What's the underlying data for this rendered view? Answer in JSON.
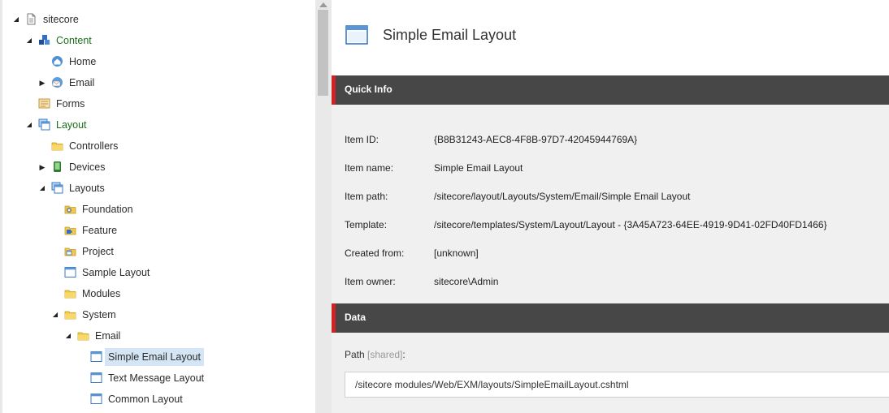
{
  "tree": {
    "nodes": [
      {
        "label": "sitecore",
        "icon": "document-icon",
        "expanded": true,
        "green": false
      },
      {
        "label": "Content",
        "icon": "content-cubes-icon",
        "expanded": true,
        "green": true
      },
      {
        "label": "Home",
        "icon": "home-icon",
        "expanded": null,
        "green": false
      },
      {
        "label": "Email",
        "icon": "email-globe-icon",
        "expanded": false,
        "green": false
      },
      {
        "label": "Forms",
        "icon": "forms-icon",
        "expanded": null,
        "green": false
      },
      {
        "label": "Layout",
        "icon": "layout-icon",
        "expanded": true,
        "green": true
      },
      {
        "label": "Controllers",
        "icon": "folder-icon",
        "expanded": null,
        "green": false
      },
      {
        "label": "Devices",
        "icon": "device-icon",
        "expanded": false,
        "green": false
      },
      {
        "label": "Layouts",
        "icon": "layout-icon",
        "expanded": true,
        "green": false
      },
      {
        "label": "Foundation",
        "icon": "folder-gear-icon",
        "expanded": null,
        "green": false
      },
      {
        "label": "Feature",
        "icon": "folder-puzzle-icon",
        "expanded": null,
        "green": false
      },
      {
        "label": "Project",
        "icon": "folder-layout-icon",
        "expanded": null,
        "green": false
      },
      {
        "label": "Sample Layout",
        "icon": "window-icon",
        "expanded": null,
        "green": false
      },
      {
        "label": "Modules",
        "icon": "folder-icon",
        "expanded": null,
        "green": false
      },
      {
        "label": "System",
        "icon": "folder-icon",
        "expanded": true,
        "green": false
      },
      {
        "label": "Email",
        "icon": "folder-icon",
        "expanded": true,
        "green": false
      },
      {
        "label": "Simple Email Layout",
        "icon": "window-icon",
        "expanded": null,
        "green": false,
        "selected": true
      },
      {
        "label": "Text Message Layout",
        "icon": "window-icon",
        "expanded": null,
        "green": false
      },
      {
        "label": "Common Layout",
        "icon": "window-icon",
        "expanded": null,
        "green": false
      }
    ]
  },
  "header": {
    "title": "Simple Email Layout",
    "icon": "window-icon"
  },
  "quick_info": {
    "title": "Quick Info",
    "rows": [
      {
        "label": "Item ID:",
        "value": "{B8B31243-AEC8-4F8B-97D7-42045944769A}"
      },
      {
        "label": "Item name:",
        "value": "Simple Email Layout"
      },
      {
        "label": "Item path:",
        "value": "/sitecore/layout/Layouts/System/Email/Simple Email Layout"
      },
      {
        "label": "Template:",
        "value": "/sitecore/templates/System/Layout/Layout - {3A45A723-64EE-4919-9D41-02FD40FD1466}"
      },
      {
        "label": "Created from:",
        "value": "[unknown]"
      },
      {
        "label": "Item owner:",
        "value": "sitecore\\Admin"
      }
    ]
  },
  "data_section": {
    "title": "Data",
    "path_label": "Path",
    "path_shared": "[shared]",
    "path_colon": ":",
    "path_value": "/sitecore modules/Web/EXM/layouts/SimpleEmailLayout.cshtml"
  },
  "colors": {
    "accent": "#d02424",
    "section_bg": "#474747",
    "selected_bg": "#d4e6f5",
    "green_label": "#1b6d1b"
  }
}
